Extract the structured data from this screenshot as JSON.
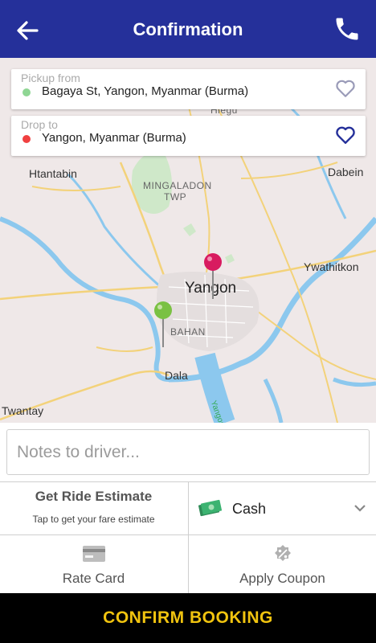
{
  "header": {
    "title": "Confirmation",
    "back_icon": "arrow-left-icon",
    "call_icon": "phone-icon",
    "bg_color": "#25309a"
  },
  "pickup": {
    "caption": "Pickup from",
    "address": "Bagaya St, Yangon, Myanmar (Burma)",
    "dot_color": "#8fd694",
    "favorite_icon": "heart-outline-icon"
  },
  "dropoff": {
    "caption": "Drop to",
    "address": "Yangon, Myanmar (Burma)",
    "dot_color": "#f04040",
    "favorite_icon": "heart-outline-icon"
  },
  "map": {
    "labels": {
      "hlegu": "Hlegu",
      "htantabin": "Htantabin",
      "dabein": "Dabein",
      "mingaladon": "MINGALADON",
      "twp": "TWP",
      "ywathitkon": "Ywathitkon",
      "yangon": "Yangon",
      "bahan": "BAHAN",
      "dala": "Dala",
      "twantay": "Twantay",
      "river": "Yangon"
    },
    "pickup_pin_color": "#7ac143",
    "dropoff_pin_color": "#d81b60"
  },
  "notes": {
    "placeholder": "Notes to driver..."
  },
  "estimate": {
    "title": "Get Ride Estimate",
    "subtitle": "Tap to get your fare estimate"
  },
  "payment": {
    "label": "Cash",
    "icon": "money-icon"
  },
  "rate_card": {
    "label": "Rate Card",
    "icon": "credit-card-icon"
  },
  "coupon": {
    "label": "Apply Coupon",
    "icon": "coupon-gear-icon"
  },
  "confirm": {
    "label": "CONFIRM BOOKING",
    "color": "#f1c40f"
  }
}
